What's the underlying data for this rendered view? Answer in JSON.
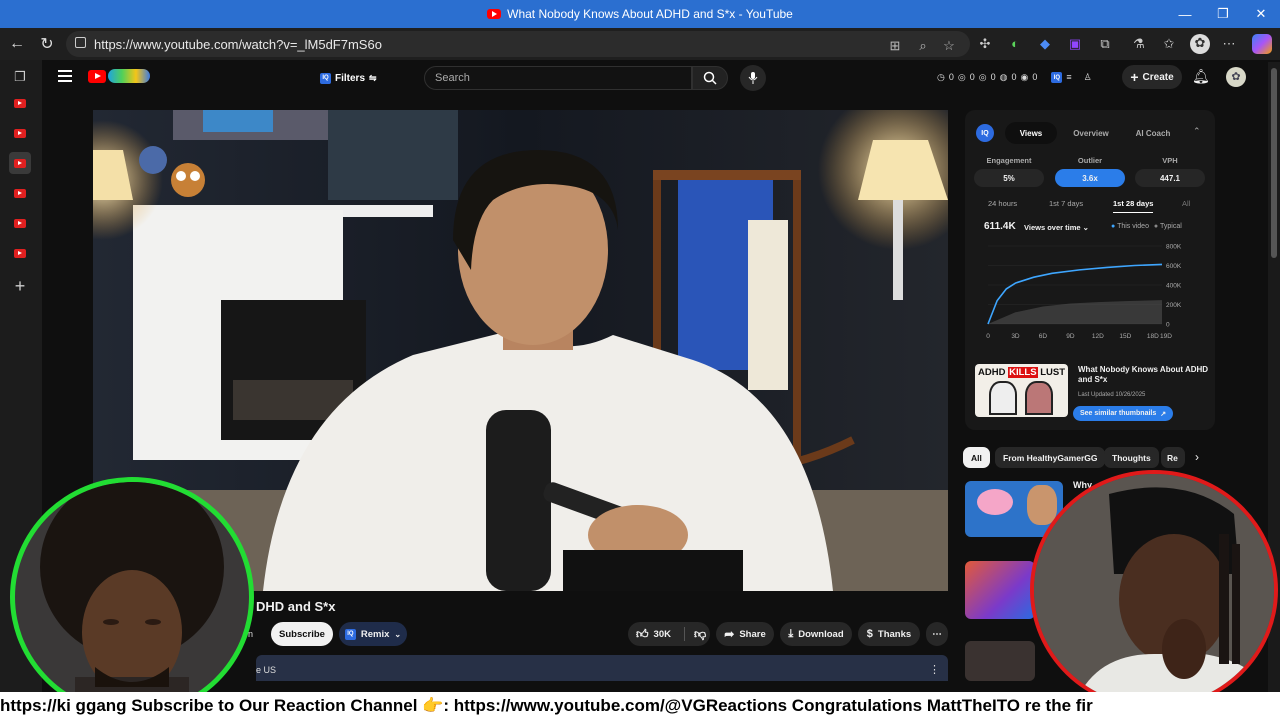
{
  "window": {
    "title": "What Nobody Knows About ADHD and S*x - YouTube",
    "controls": [
      "—",
      "❐",
      "✕"
    ]
  },
  "browser": {
    "url": "https://www.youtube.com/watch?v=_lM5dF7mS6o"
  },
  "youtube_header": {
    "filters_label": "Filters",
    "search_placeholder": "Search",
    "stats": [
      "0",
      "0",
      "0",
      "0",
      "0"
    ],
    "create_label": "Create"
  },
  "video": {
    "title_visible": "DHD and S*x",
    "actions": {
      "subscribe": "Subscribe",
      "remix": "Remix",
      "likes": "30K",
      "share": "Share",
      "download": "Download",
      "thanks": "Thanks"
    },
    "channel_fragment": "n",
    "description_fragment": "e US"
  },
  "vidiq_panel": {
    "tabs": [
      "Views",
      "Overview",
      "AI Coach"
    ],
    "metrics": [
      {
        "label": "Engagement",
        "value": "5%"
      },
      {
        "label": "Outlier",
        "value": "3.6x"
      },
      {
        "label": "VPH",
        "value": "447.1"
      }
    ],
    "ranges": [
      "24 hours",
      "1st 7 days",
      "1st 28 days",
      "All"
    ],
    "active_range": "1st 28 days",
    "views_total": "611.4K",
    "views_dropdown": "Views over time",
    "legend": [
      "This video",
      "Typical"
    ],
    "thumb_text": [
      "ADHD",
      "KILLS",
      "LUST"
    ],
    "card_title": "What Nobody Knows About ADHD and S*x",
    "card_updated": "Last Updated 10/26/2025",
    "similar_btn": "See similar thumbnails"
  },
  "chart_data": {
    "type": "area",
    "x_ticks": [
      "0",
      "3D",
      "6D",
      "9D",
      "12D",
      "15D",
      "18D",
      "19D"
    ],
    "y_ticks": [
      "800K",
      "600K",
      "400K",
      "200K",
      "0"
    ],
    "ylim": [
      0,
      800000
    ],
    "series": [
      {
        "name": "This video",
        "x": [
          0,
          1,
          2,
          3,
          5,
          7,
          10,
          13,
          16,
          19
        ],
        "values": [
          0,
          240000,
          360000,
          420000,
          480000,
          520000,
          555000,
          580000,
          600000,
          611400
        ]
      },
      {
        "name": "Typical",
        "x": [
          0,
          3,
          6,
          9,
          12,
          15,
          19
        ],
        "values": [
          0,
          120000,
          180000,
          210000,
          225000,
          235000,
          245000
        ]
      }
    ],
    "colors": {
      "this_video": "#3ea6ff",
      "typical": "#555555"
    }
  },
  "related": {
    "chips": [
      "All",
      "From HealthyGamerGG",
      "Thoughts",
      "Re"
    ],
    "first_title_fragment": "Why"
  },
  "ticker": {
    "text": "https://ki                 ggang   Subscribe to Our Reaction Channel 👉: https://www.youtube.com/@VGReactions   Congratulations MattTheITO                re the fir"
  }
}
